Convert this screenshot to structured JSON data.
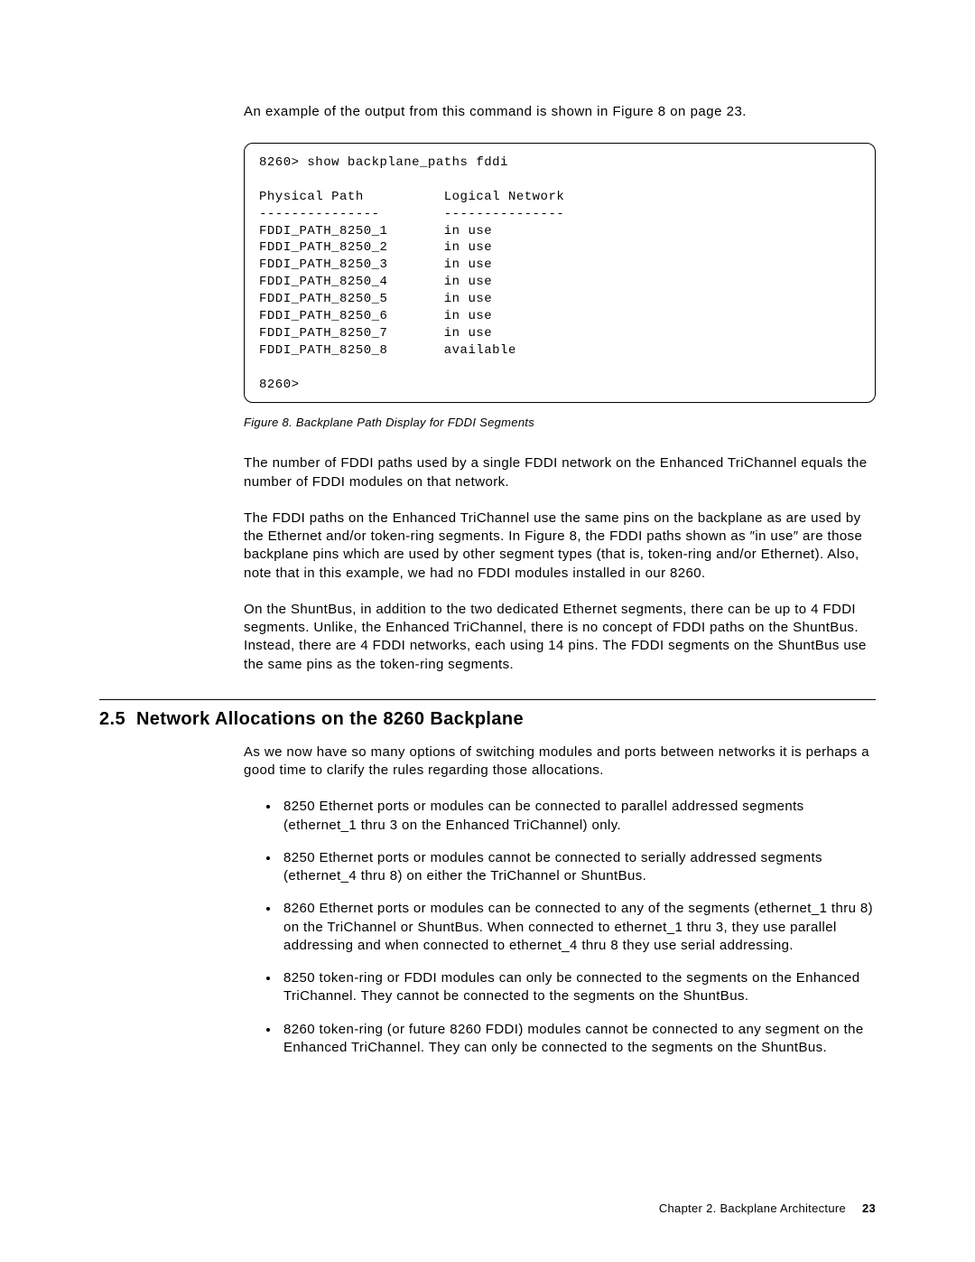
{
  "intro": "An example of the output from this command is shown in Figure 8 on page 23.",
  "figure": {
    "command": "8260> show backplane_paths fddi",
    "header_left": "Physical Path",
    "header_right": "Logical Network",
    "rows": [
      {
        "path": "FDDI_PATH_8250_1",
        "status": "in use"
      },
      {
        "path": "FDDI_PATH_8250_2",
        "status": "in use"
      },
      {
        "path": "FDDI_PATH_8250_3",
        "status": "in use"
      },
      {
        "path": "FDDI_PATH_8250_4",
        "status": "in use"
      },
      {
        "path": "FDDI_PATH_8250_5",
        "status": "in use"
      },
      {
        "path": "FDDI_PATH_8250_6",
        "status": "in use"
      },
      {
        "path": "FDDI_PATH_8250_7",
        "status": "in use"
      },
      {
        "path": "FDDI_PATH_8250_8",
        "status": "available"
      }
    ],
    "prompt": "8260>",
    "caption": "Figure 8. Backplane Path Display for FDDI Segments"
  },
  "para1": "The number of FDDI paths used by a single FDDI network on the Enhanced TriChannel equals the number of FDDI modules on that network.",
  "para2": "The FDDI paths on the Enhanced TriChannel use the same pins on the backplane as are used by the Ethernet and/or token-ring segments. In Figure 8, the FDDI paths shown as ″in use″ are those backplane pins which are used by other segment types (that is, token-ring and/or Ethernet). Also, note that in this example, we had no FDDI modules installed in our 8260.",
  "para3": "On the ShuntBus, in addition to the two dedicated Ethernet segments, there can be up to 4 FDDI segments. Unlike, the Enhanced TriChannel, there is no concept of FDDI paths on the ShuntBus. Instead, there are 4 FDDI networks, each using 14 pins. The FDDI segments on the ShuntBus use the same pins as the token-ring segments.",
  "section": {
    "number": "2.5",
    "title": "Network Allocations on the 8260 Backplane",
    "intro": "As we now have so many options of switching modules and ports between networks it is perhaps a good time to clarify the rules regarding those allocations.",
    "bullets": [
      "8250 Ethernet ports or modules can be connected to parallel addressed segments (ethernet_1 thru 3 on the Enhanced TriChannel) only.",
      "8250 Ethernet ports or modules cannot be connected to serially addressed segments (ethernet_4 thru 8) on either the TriChannel or ShuntBus.",
      "8260 Ethernet ports or modules can be connected to any of the segments (ethernet_1 thru 8) on the TriChannel or ShuntBus. When connected to ethernet_1 thru 3, they use parallel addressing and when connected to ethernet_4 thru 8 they use serial addressing.",
      "8250 token-ring or FDDI modules can only be connected to the segments on the Enhanced TriChannel. They cannot be connected to the segments on the ShuntBus.",
      "8260 token-ring (or future 8260 FDDI) modules cannot be connected to any segment on the Enhanced TriChannel. They can only be connected to the segments on the ShuntBus."
    ]
  },
  "footer": {
    "chapter": "Chapter 2.  Backplane Architecture",
    "page": "23"
  }
}
